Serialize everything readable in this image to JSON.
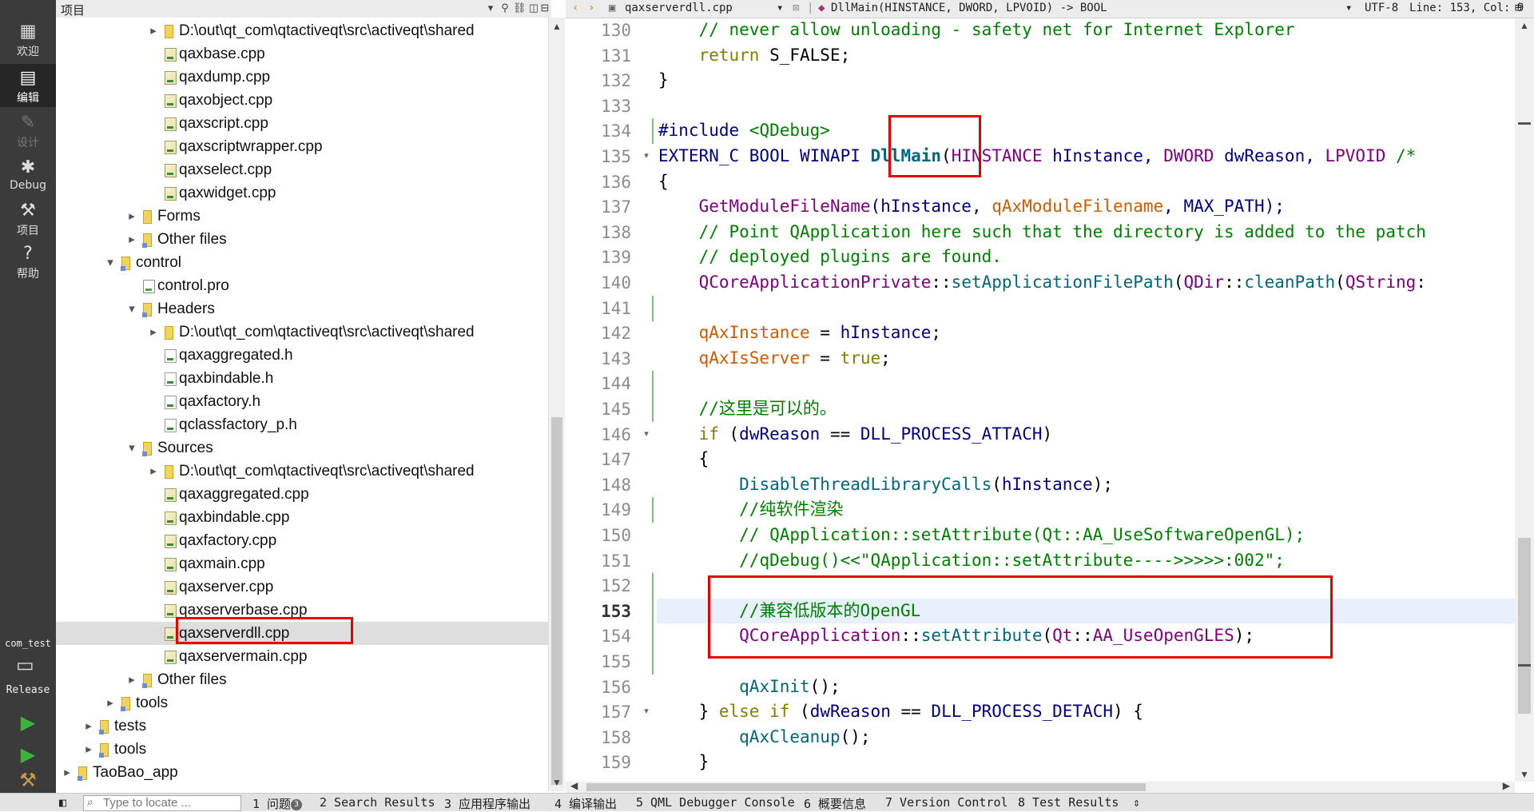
{
  "modebar": {
    "modes": [
      {
        "label": "欢迎",
        "icon": "grid-icon"
      },
      {
        "label": "编辑",
        "icon": "document-icon"
      },
      {
        "label": "设计",
        "icon": "pencil-icon"
      },
      {
        "label": "Debug",
        "icon": "bug-icon"
      },
      {
        "label": "项目",
        "icon": "wrench-icon"
      },
      {
        "label": "帮助",
        "icon": "help-icon"
      }
    ],
    "kit_name": "com_test",
    "build_config": "Release"
  },
  "project_panel": {
    "title": "项目",
    "tree": [
      {
        "label": "D:\\out\\qt_com\\qtactiveqt\\src\\activeqt\\shared",
        "icon": "folder",
        "depth": 5,
        "arrow": "▸"
      },
      {
        "label": "qaxbase.cpp",
        "icon": "cpp",
        "depth": 5,
        "arrow": ""
      },
      {
        "label": "qaxdump.cpp",
        "icon": "cpp",
        "depth": 5,
        "arrow": ""
      },
      {
        "label": "qaxobject.cpp",
        "icon": "cpp",
        "depth": 5,
        "arrow": ""
      },
      {
        "label": "qaxscript.cpp",
        "icon": "cpp",
        "depth": 5,
        "arrow": ""
      },
      {
        "label": "qaxscriptwrapper.cpp",
        "icon": "cpp",
        "depth": 5,
        "arrow": ""
      },
      {
        "label": "qaxselect.cpp",
        "icon": "cpp",
        "depth": 5,
        "arrow": ""
      },
      {
        "label": "qaxwidget.cpp",
        "icon": "cpp",
        "depth": 5,
        "arrow": ""
      },
      {
        "label": "Forms",
        "icon": "folder",
        "depth": 4,
        "arrow": "▸"
      },
      {
        "label": "Other files",
        "icon": "proj",
        "depth": 4,
        "arrow": "▸"
      },
      {
        "label": "control",
        "icon": "proj",
        "depth": 3,
        "arrow": "▾"
      },
      {
        "label": "control.pro",
        "icon": "pro",
        "depth": 4,
        "arrow": ""
      },
      {
        "label": "Headers",
        "icon": "proj",
        "depth": 4,
        "arrow": "▾"
      },
      {
        "label": "D:\\out\\qt_com\\qtactiveqt\\src\\activeqt\\shared",
        "icon": "folder",
        "depth": 5,
        "arrow": "▸"
      },
      {
        "label": "qaxaggregated.h",
        "icon": "h",
        "depth": 5,
        "arrow": ""
      },
      {
        "label": "qaxbindable.h",
        "icon": "h",
        "depth": 5,
        "arrow": ""
      },
      {
        "label": "qaxfactory.h",
        "icon": "h",
        "depth": 5,
        "arrow": ""
      },
      {
        "label": "qclassfactory_p.h",
        "icon": "h",
        "depth": 5,
        "arrow": ""
      },
      {
        "label": "Sources",
        "icon": "proj",
        "depth": 4,
        "arrow": "▾"
      },
      {
        "label": "D:\\out\\qt_com\\qtactiveqt\\src\\activeqt\\shared",
        "icon": "folder",
        "depth": 5,
        "arrow": "▸"
      },
      {
        "label": "qaxaggregated.cpp",
        "icon": "cpp",
        "depth": 5,
        "arrow": ""
      },
      {
        "label": "qaxbindable.cpp",
        "icon": "cpp",
        "depth": 5,
        "arrow": ""
      },
      {
        "label": "qaxfactory.cpp",
        "icon": "cpp",
        "depth": 5,
        "arrow": ""
      },
      {
        "label": "qaxmain.cpp",
        "icon": "cpp",
        "depth": 5,
        "arrow": ""
      },
      {
        "label": "qaxserver.cpp",
        "icon": "cpp",
        "depth": 5,
        "arrow": ""
      },
      {
        "label": "qaxserverbase.cpp",
        "icon": "cpp",
        "depth": 5,
        "arrow": ""
      },
      {
        "label": "qaxserverdll.cpp",
        "icon": "cpp",
        "depth": 5,
        "arrow": "",
        "selected": true
      },
      {
        "label": "qaxservermain.cpp",
        "icon": "cpp",
        "depth": 5,
        "arrow": ""
      },
      {
        "label": "Other files",
        "icon": "proj",
        "depth": 4,
        "arrow": "▸"
      },
      {
        "label": "tools",
        "icon": "proj",
        "depth": 3,
        "arrow": "▸"
      },
      {
        "label": "tests",
        "icon": "proj",
        "depth": 2,
        "arrow": "▸"
      },
      {
        "label": "tools",
        "icon": "proj",
        "depth": 2,
        "arrow": "▸"
      },
      {
        "label": "TaoBao_app",
        "icon": "proj",
        "depth": 1,
        "arrow": "▸"
      }
    ]
  },
  "editor_header": {
    "file_name": "qaxserverdll.cpp",
    "symbol": "DllMain(HINSTANCE, DWORD, LPVOID) -> BOOL",
    "encoding": "UTF-8",
    "position": "Line: 153, Col: 9"
  },
  "editor": {
    "current_line": 153,
    "lines": [
      {
        "n": 130,
        "fold": "",
        "tokens": [
          [
            "    ",
            "def"
          ],
          [
            "// never allow unloading - safety net for Internet Explorer",
            "cm"
          ]
        ]
      },
      {
        "n": 131,
        "fold": "",
        "tokens": [
          [
            "    ",
            "def"
          ],
          [
            "return",
            "kw"
          ],
          [
            " S_FALSE;",
            "def"
          ]
        ]
      },
      {
        "n": 132,
        "fold": "",
        "tokens": [
          [
            "}",
            "def"
          ]
        ]
      },
      {
        "n": 133,
        "fold": "",
        "tokens": []
      },
      {
        "n": 134,
        "fold": "",
        "tokens": [
          [
            "#include ",
            "pre"
          ],
          [
            "<QDebug>",
            "str"
          ]
        ]
      },
      {
        "n": 135,
        "fold": "▾",
        "tokens": [
          [
            "EXTERN_C BOOL WINAPI ",
            "pre"
          ],
          [
            "DllMain",
            "b"
          ],
          [
            "(",
            "def"
          ],
          [
            "HINSTANCE",
            "ty"
          ],
          [
            " hInstance, ",
            "pre"
          ],
          [
            "DWORD",
            "ty"
          ],
          [
            " dwReason, ",
            "pre"
          ],
          [
            "LPVOID",
            "ty"
          ],
          [
            " /*",
            "cm"
          ]
        ]
      },
      {
        "n": 136,
        "fold": "",
        "tokens": [
          [
            "{",
            "def"
          ]
        ]
      },
      {
        "n": 137,
        "fold": "",
        "tokens": [
          [
            "    ",
            "def"
          ],
          [
            "GetModuleFileName",
            "ty"
          ],
          [
            "(hInstance, ",
            "pre"
          ],
          [
            "qAxModuleFilename",
            "var"
          ],
          [
            ", MAX_PATH);",
            "pre"
          ]
        ]
      },
      {
        "n": 138,
        "fold": "",
        "tokens": [
          [
            "    ",
            "def"
          ],
          [
            "// Point QApplication here such that the directory is added to the patch",
            "cm"
          ]
        ]
      },
      {
        "n": 139,
        "fold": "",
        "tokens": [
          [
            "    ",
            "def"
          ],
          [
            "// deployed plugins are found.",
            "cm"
          ]
        ]
      },
      {
        "n": 140,
        "fold": "",
        "tokens": [
          [
            "    ",
            "def"
          ],
          [
            "QCoreApplicationPrivate",
            "ty"
          ],
          [
            "::",
            "def"
          ],
          [
            "setApplicationFilePath",
            "fn"
          ],
          [
            "(",
            "def"
          ],
          [
            "QDir",
            "ty"
          ],
          [
            "::",
            "def"
          ],
          [
            "cleanPath",
            "fn"
          ],
          [
            "(",
            "def"
          ],
          [
            "QString",
            "ty"
          ],
          [
            ":",
            "def"
          ]
        ]
      },
      {
        "n": 141,
        "fold": "",
        "tokens": []
      },
      {
        "n": 142,
        "fold": "",
        "tokens": [
          [
            "    ",
            "def"
          ],
          [
            "qAxInstance",
            "var"
          ],
          [
            " = ",
            "def"
          ],
          [
            "hInstance",
            "pre"
          ],
          [
            ";",
            "def"
          ]
        ]
      },
      {
        "n": 143,
        "fold": "",
        "tokens": [
          [
            "    ",
            "def"
          ],
          [
            "qAxIsServer",
            "var"
          ],
          [
            " = ",
            "def"
          ],
          [
            "true",
            "kw"
          ],
          [
            ";",
            "def"
          ]
        ]
      },
      {
        "n": 144,
        "fold": "",
        "tokens": []
      },
      {
        "n": 145,
        "fold": "",
        "tokens": [
          [
            "    ",
            "def"
          ],
          [
            "//这里是可以的。",
            "cm"
          ]
        ]
      },
      {
        "n": 146,
        "fold": "▾",
        "tokens": [
          [
            "    ",
            "def"
          ],
          [
            "if",
            "kw"
          ],
          [
            " (",
            "def"
          ],
          [
            "dwReason",
            "pre"
          ],
          [
            " == ",
            "def"
          ],
          [
            "DLL_PROCESS_ATTACH",
            "pre"
          ],
          [
            ")",
            "def"
          ]
        ]
      },
      {
        "n": 147,
        "fold": "",
        "tokens": [
          [
            "    {",
            "def"
          ]
        ]
      },
      {
        "n": 148,
        "fold": "",
        "tokens": [
          [
            "        ",
            "def"
          ],
          [
            "DisableThreadLibraryCalls",
            "fn"
          ],
          [
            "(",
            "def"
          ],
          [
            "hInstance",
            "pre"
          ],
          [
            ");",
            "def"
          ]
        ]
      },
      {
        "n": 149,
        "fold": "",
        "tokens": [
          [
            "        ",
            "def"
          ],
          [
            "//纯软件渲染",
            "cm"
          ]
        ]
      },
      {
        "n": 150,
        "fold": "",
        "tokens": [
          [
            "        ",
            "def"
          ],
          [
            "// QApplication::setAttribute(Qt::AA_UseSoftwareOpenGL);",
            "cm"
          ]
        ]
      },
      {
        "n": 151,
        "fold": "",
        "tokens": [
          [
            "        ",
            "def"
          ],
          [
            "//qDebug()<<\"QApplication::setAttribute---->>>>>:002\";",
            "cm"
          ]
        ]
      },
      {
        "n": 152,
        "fold": "",
        "tokens": []
      },
      {
        "n": 153,
        "fold": "",
        "tokens": [
          [
            "        ",
            "def"
          ],
          [
            "//兼容低版本的OpenGL",
            "cm"
          ]
        ]
      },
      {
        "n": 154,
        "fold": "",
        "tokens": [
          [
            "        ",
            "def"
          ],
          [
            "QCoreApplication",
            "ty"
          ],
          [
            "::",
            "def"
          ],
          [
            "setAttribute",
            "fn"
          ],
          [
            "(",
            "def"
          ],
          [
            "Qt",
            "ty"
          ],
          [
            "::",
            "def"
          ],
          [
            "AA_UseOpenGLES",
            "ty"
          ],
          [
            ");",
            "def"
          ]
        ]
      },
      {
        "n": 155,
        "fold": "",
        "tokens": []
      },
      {
        "n": 156,
        "fold": "",
        "tokens": [
          [
            "        ",
            "def"
          ],
          [
            "qAxInit",
            "fn"
          ],
          [
            "();",
            "def"
          ]
        ]
      },
      {
        "n": 157,
        "fold": "▾",
        "tokens": [
          [
            "    } ",
            "def"
          ],
          [
            "else",
            "kw"
          ],
          [
            " ",
            "def"
          ],
          [
            "if",
            "kw"
          ],
          [
            " (",
            "def"
          ],
          [
            "dwReason",
            "pre"
          ],
          [
            " == ",
            "def"
          ],
          [
            "DLL_PROCESS_DETACH",
            "pre"
          ],
          [
            ") {",
            "def"
          ]
        ]
      },
      {
        "n": 158,
        "fold": "",
        "tokens": [
          [
            "        ",
            "def"
          ],
          [
            "qAxCleanup",
            "fn"
          ],
          [
            "();",
            "def"
          ]
        ]
      },
      {
        "n": 159,
        "fold": "",
        "tokens": [
          [
            "    }",
            "def"
          ]
        ]
      }
    ]
  },
  "statusbar": {
    "locator_placeholder": "Type to locate ...",
    "panes": [
      "1 问题",
      "2 Search Results",
      "3 应用程序输出",
      "4 编译输出",
      "5 QML Debugger Console",
      "6 概要信息",
      "7 Version Control",
      "8 Test Results"
    ],
    "issues_badge": "3"
  },
  "colors": {
    "annotation": "#e60000",
    "modebar_bg": "#3b3b3b",
    "current_line_bg": "#e8f1fb"
  }
}
